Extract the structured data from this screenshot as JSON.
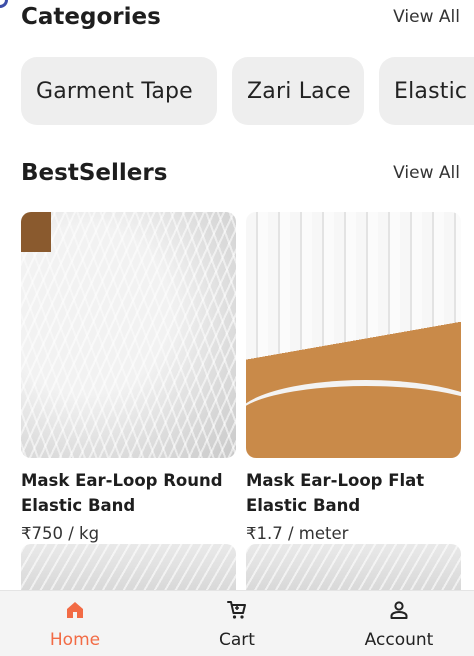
{
  "colors": {
    "accent": "#f26b45",
    "chip_bg": "#eeeeee",
    "nav_bg": "#f4f4f4"
  },
  "categories": {
    "title": "Categories",
    "view_all": "View All",
    "items": [
      {
        "label": "Garment Tape"
      },
      {
        "label": "Zari Lace"
      },
      {
        "label": "Elastic"
      }
    ]
  },
  "bestsellers": {
    "title": "BestSellers",
    "view_all": "View All",
    "products": [
      {
        "name": "Mask Ear-Loop Round Elastic Band",
        "price": "₹750 / kg"
      },
      {
        "name": "Mask Ear-Loop Flat Elastic Band",
        "price": "₹1.7 / meter"
      }
    ]
  },
  "nav": {
    "items": [
      {
        "label": "Home",
        "icon": "home-icon",
        "active": true
      },
      {
        "label": "Cart",
        "icon": "cart-icon",
        "active": false
      },
      {
        "label": "Account",
        "icon": "account-icon",
        "active": false
      }
    ]
  }
}
